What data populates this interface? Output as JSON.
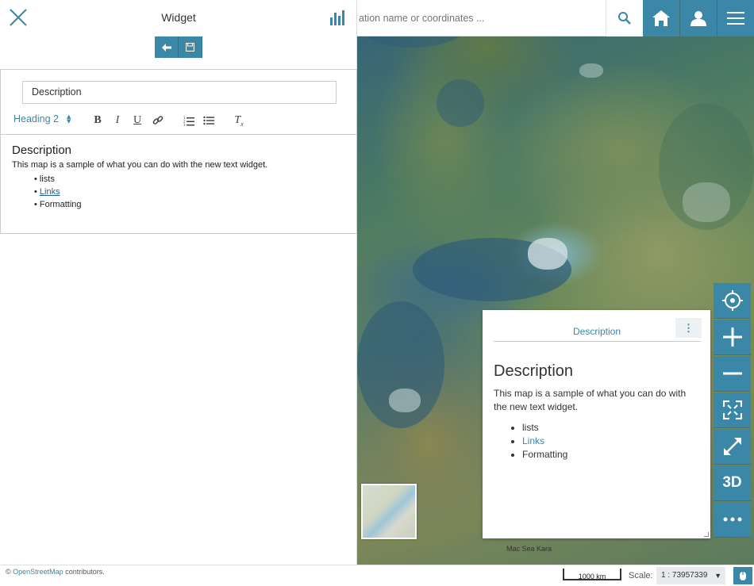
{
  "panel": {
    "title": "Widget",
    "description_value": "Description",
    "heading_select": "Heading 2"
  },
  "editor_content": {
    "heading": "Description",
    "paragraph": "This map is a sample of what you can do with the new text widget.",
    "items": [
      "lists",
      "Links",
      "Formatting"
    ]
  },
  "search": {
    "placeholder": "ation name or coordinates ..."
  },
  "widget": {
    "title": "Description",
    "heading": "Description",
    "paragraph": "This map is a sample of what you can do with the new text widget.",
    "items": [
      "lists",
      "Links",
      "Formatting"
    ],
    "menu_icon": "⋮"
  },
  "controls": {
    "threed_label": "3D"
  },
  "map_labels": {
    "bottom_place": "Mac  Sea  Kara"
  },
  "footer": {
    "copyright": "©",
    "osm_link": "OpenStreetMap",
    "contributors": "contributors.",
    "scalebar": "1000 km",
    "scale_label": "Scale:",
    "scale_value": "1 : 73957339",
    "scale_arrow": "▼"
  },
  "colors": {
    "accent": "#3a87a8",
    "link": "#1a5e9e"
  },
  "icons": [
    "close-icon",
    "chart-icon",
    "back-arrow-icon",
    "save-icon",
    "search-icon",
    "home-icon",
    "user-icon",
    "menu-icon",
    "locate-icon",
    "zoom-in-icon",
    "zoom-out-icon",
    "fullscreen-icon",
    "expand-icon",
    "more-icon",
    "mouse-icon"
  ]
}
